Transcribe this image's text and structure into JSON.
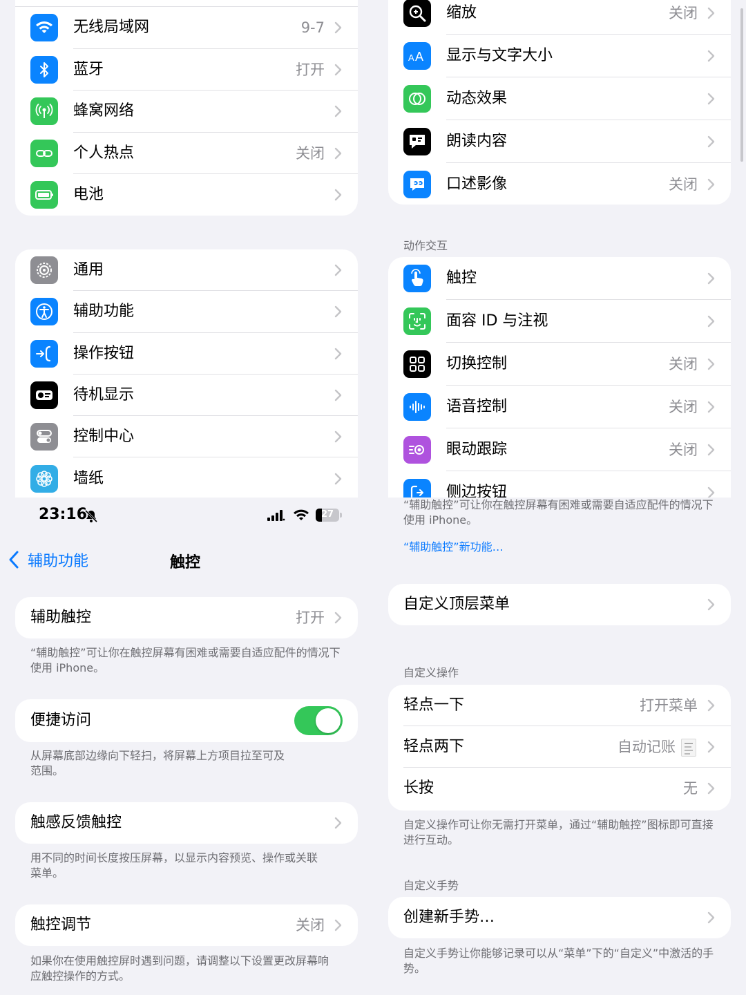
{
  "colors": {
    "accent": "#0a7aff",
    "toggle_on": "#34c759",
    "secondary_text": "#8e8e93",
    "background": "#f2f2f7"
  },
  "tl": {
    "card1": [
      {
        "label": "无线局域网",
        "value": "9-7",
        "icon": "wifi-icon",
        "color": "#0a84ff"
      },
      {
        "label": "蓝牙",
        "value": "打开",
        "icon": "bluetooth-icon",
        "color": "#0a84ff"
      },
      {
        "label": "蜂窝网络",
        "value": "",
        "icon": "cellular-icon",
        "color": "#34c759"
      },
      {
        "label": "个人热点",
        "value": "关闭",
        "icon": "hotspot-icon",
        "color": "#34c759"
      },
      {
        "label": "电池",
        "value": "",
        "icon": "battery-icon",
        "color": "#34c759"
      }
    ],
    "card2": [
      {
        "label": "通用",
        "value": "",
        "icon": "gear-icon",
        "color": "#8e8e93"
      },
      {
        "label": "辅助功能",
        "value": "",
        "icon": "accessibility-icon",
        "color": "#0a84ff"
      },
      {
        "label": "操作按钮",
        "value": "",
        "icon": "action-button-icon",
        "color": "#0a84ff"
      },
      {
        "label": "待机显示",
        "value": "",
        "icon": "standby-icon",
        "color": "#000000"
      },
      {
        "label": "控制中心",
        "value": "",
        "icon": "control-center-icon",
        "color": "#8e8e93"
      },
      {
        "label": "墙纸",
        "value": "",
        "icon": "wallpaper-icon",
        "color": "#32ade6"
      }
    ]
  },
  "status": {
    "time": "23:16",
    "battery": "27"
  },
  "nav": {
    "back": "辅助功能",
    "title": "触控"
  },
  "bl": {
    "assistive_touch": {
      "label": "辅助触控",
      "value": "打开"
    },
    "assistive_touch_note": "“辅助触控”可让你在触控屏幕有困难或需要自适应配件的情况下使用 iPhone。",
    "reachability": {
      "label": "便捷访问",
      "toggle": true
    },
    "reachability_note": "从屏幕底部边缘向下轻扫，将屏幕上方项目拉至可及范围。",
    "haptic": {
      "label": "触感反馈触控"
    },
    "haptic_note": "用不同的时间长度按压屏幕，以显示内容预览、操作或关联菜单。",
    "touch_accom": {
      "label": "触控调节",
      "value": "关闭"
    },
    "touch_accom_note": "如果你在使用触控屏时遇到问题，请调整以下设置更改屏幕响应触控操作的方式。"
  },
  "tr": {
    "vision": [
      {
        "label": "缩放",
        "value": "关闭",
        "icon": "zoom-icon",
        "color": "#000000"
      },
      {
        "label": "显示与文字大小",
        "value": "",
        "icon": "text-size-icon",
        "color": "#0a84ff"
      },
      {
        "label": "动态效果",
        "value": "",
        "icon": "motion-icon",
        "color": "#34c759"
      },
      {
        "label": "朗读内容",
        "value": "",
        "icon": "spoken-content-icon",
        "color": "#000000"
      },
      {
        "label": "口述影像",
        "value": "关闭",
        "icon": "audio-description-icon",
        "color": "#0a84ff"
      }
    ],
    "section": "动作交互",
    "physical": [
      {
        "label": "触控",
        "value": "",
        "icon": "touch-icon",
        "color": "#0a84ff"
      },
      {
        "label": "面容 ID 与注视",
        "value": "",
        "icon": "face-id-icon",
        "color": "#34c759"
      },
      {
        "label": "切换控制",
        "value": "关闭",
        "icon": "switch-control-icon",
        "color": "#000000"
      },
      {
        "label": "语音控制",
        "value": "关闭",
        "icon": "voice-control-icon",
        "color": "#0a84ff"
      },
      {
        "label": "眼动跟踪",
        "value": "关闭",
        "icon": "eye-tracking-icon",
        "color": "#af52de"
      },
      {
        "label": "侧边按钮",
        "value": "",
        "icon": "side-button-icon",
        "color": "#0a84ff"
      }
    ]
  },
  "br": {
    "top_note": "“辅助触控”可让你在触控屏幕有困难或需要自适应配件的情况下使用 iPhone。",
    "top_link": "“辅助触控”新功能…",
    "custom_top_menu": "自定义顶层菜单",
    "custom_actions_header": "自定义操作",
    "actions": [
      {
        "label": "轻点一下",
        "value": "打开菜单"
      },
      {
        "label": "轻点两下",
        "value": "自动记账"
      },
      {
        "label": "长按",
        "value": "无"
      }
    ],
    "actions_note": "自定义操作可让你无需打开菜单，通过“辅助触控”图标即可直接进行互动。",
    "custom_gestures_header": "自定义手势",
    "create_gesture": "创建新手势…",
    "gestures_note": "自定义手势让你能够记录可以从“菜单”下的“自定义”中激活的手势。"
  }
}
